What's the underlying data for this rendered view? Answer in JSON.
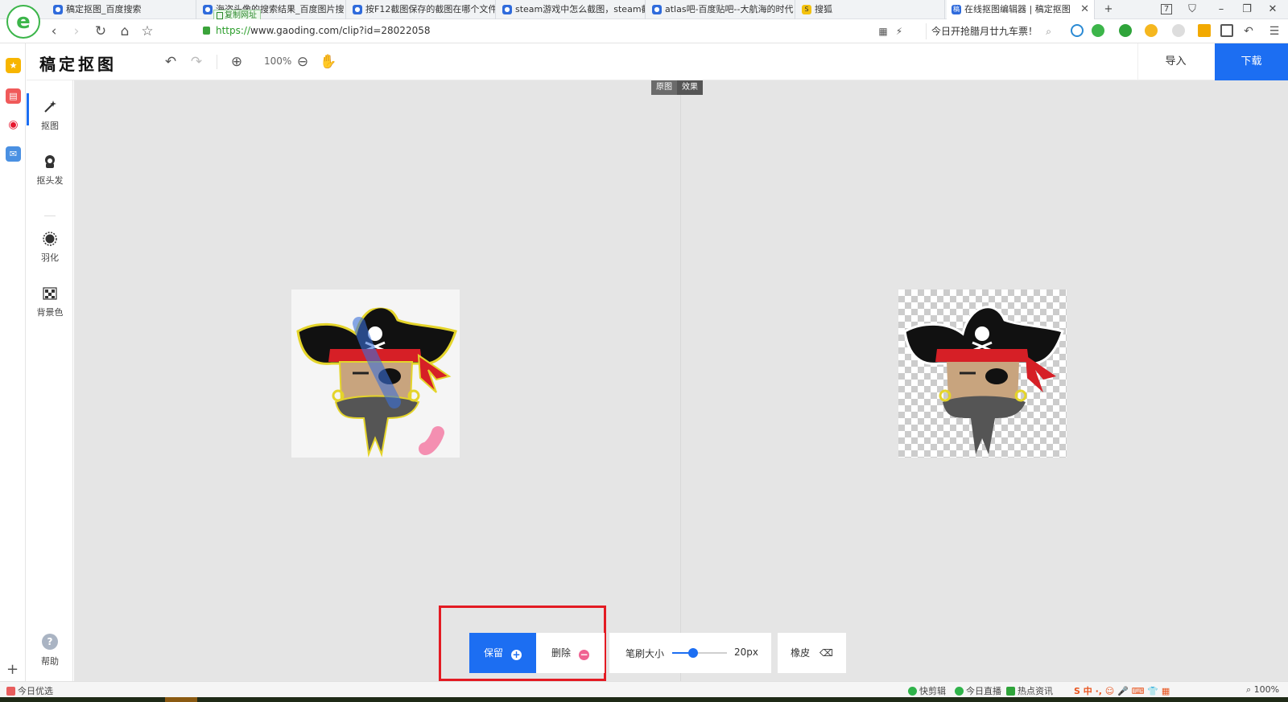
{
  "browser": {
    "tabs": [
      {
        "label": "稿定抠图_百度搜索",
        "icon": "paw-icon"
      },
      {
        "label": "海盗头像的搜索结果_百度图片搜",
        "icon": "paw-icon"
      },
      {
        "label": "按F12截图保存的截图在哪个文件",
        "icon": "paw-icon"
      },
      {
        "label": "steam游戏中怎么截图，steam截",
        "icon": "paw-icon"
      },
      {
        "label": "atlas吧-百度贴吧--大航海的时代",
        "icon": "paw-icon"
      },
      {
        "label": "搜狐",
        "icon": "sohu-icon"
      },
      {
        "label": "在线抠图编辑器 | 稿定抠图",
        "icon": "gaoding-icon",
        "active": true
      }
    ],
    "copy_url_tooltip": "复制网址",
    "tab_count": "7",
    "url_protocol": "https://",
    "url_rest": "www.gaoding.com/clip?id=28022058",
    "search_text": "今日开抢腊月廿九车票！"
  },
  "app": {
    "logo": "稿定抠图",
    "zoom_level": "100%",
    "import_label": "导入",
    "download_label": "下载"
  },
  "tools": [
    {
      "label": "抠图",
      "icon": "magic-wand-icon",
      "active": true
    },
    {
      "label": "抠头发",
      "icon": "hair-icon",
      "active": false
    },
    {
      "label": "羽化",
      "icon": "feather-icon",
      "active": false
    },
    {
      "label": "背景色",
      "icon": "checkerboard-icon",
      "active": false
    }
  ],
  "help_label": "帮助",
  "canvas": {
    "view_toggle": {
      "original": "原图",
      "effect": "效果"
    }
  },
  "bottom_toolbar": {
    "keep_label": "保留",
    "delete_label": "删除",
    "brush_size_label": "笔刷大小",
    "brush_size_value": "20px",
    "brush_slider_fraction": 0.38,
    "eraser_label": "橡皮"
  },
  "statusbar": {
    "left": "今日优选",
    "items": [
      "快剪辑",
      "今日直播",
      "热点资讯"
    ],
    "zoom": "100%"
  },
  "colors": {
    "accent": "#1c6ef2",
    "highlight_red": "#e31b23",
    "delete_pink": "#f06292"
  }
}
